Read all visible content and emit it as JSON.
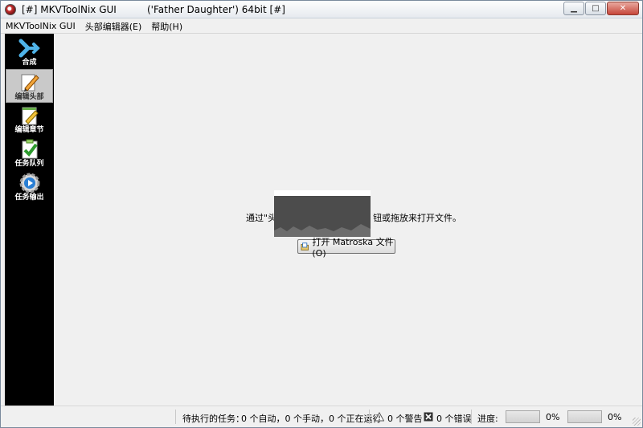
{
  "window": {
    "title_prefix": "[#] MKVToolNix GUI",
    "title_suffix": "('Father Daughter') 64bit [#]",
    "controls": {
      "minimize": "▁",
      "maximize": "□",
      "close": "✕"
    }
  },
  "menu": [
    "MKVToolNix GUI",
    "头部编辑器(E)",
    "帮助(H)"
  ],
  "sidebar": {
    "items": [
      {
        "label": "合成",
        "icon": "merge-icon",
        "active": false
      },
      {
        "label": "编辑头部",
        "icon": "edit-header-icon",
        "active": true
      },
      {
        "label": "编辑章节",
        "icon": "edit-chapters-icon",
        "active": false
      },
      {
        "label": "任务队列",
        "icon": "job-queue-icon",
        "active": false
      },
      {
        "label": "任务输出",
        "icon": "job-output-icon",
        "active": false
      }
    ]
  },
  "main": {
    "hint_left": "通过\"头",
    "hint_right": "钮或拖放来打开文件。",
    "open_button": "打开 Matroska 文件(O)"
  },
  "status": {
    "pending_label": "待执行的任务：",
    "pending_counts": "0 个自动，0 个手动，0 个正在运行",
    "warnings": "0 个警告",
    "errors": "0 个错误",
    "progress_label": "进度:",
    "progress1": "0%",
    "progress2": "0%"
  },
  "colors": {
    "sidebar_bg": "#000000",
    "active_item_bg": "#c9c9c9",
    "close_button": "#c6463a"
  }
}
